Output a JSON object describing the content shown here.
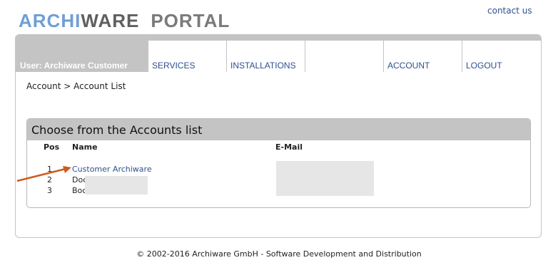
{
  "logo": {
    "part1": "ARCHI",
    "part2": "WARE",
    "part3": "PORTAL"
  },
  "header": {
    "contact_label": "contact us"
  },
  "nav": {
    "user_label": "User: Archiware Customer",
    "items": [
      {
        "label": "SERVICES"
      },
      {
        "label": "INSTALLATIONS"
      },
      {
        "label": ""
      },
      {
        "label": "ACCOUNT"
      },
      {
        "label": "LOGOUT"
      }
    ]
  },
  "breadcrumb": "Account > Account List",
  "panel": {
    "title": "Choose from the Accounts list",
    "columns": {
      "pos": "Pos",
      "name": "Name",
      "email": "E-Mail"
    },
    "rows": [
      {
        "pos": "1",
        "name": "Customer Archiware"
      },
      {
        "pos": "2",
        "name": "Doc"
      },
      {
        "pos": "3",
        "name": "Boc"
      }
    ]
  },
  "colors": {
    "accent_arrow": "#d05a1c",
    "link": "#2f4f8f",
    "nav_bg": "#c4c4c4"
  },
  "footer": "© 2002-2016 Archiware GmbH - Software Development and Distribution"
}
